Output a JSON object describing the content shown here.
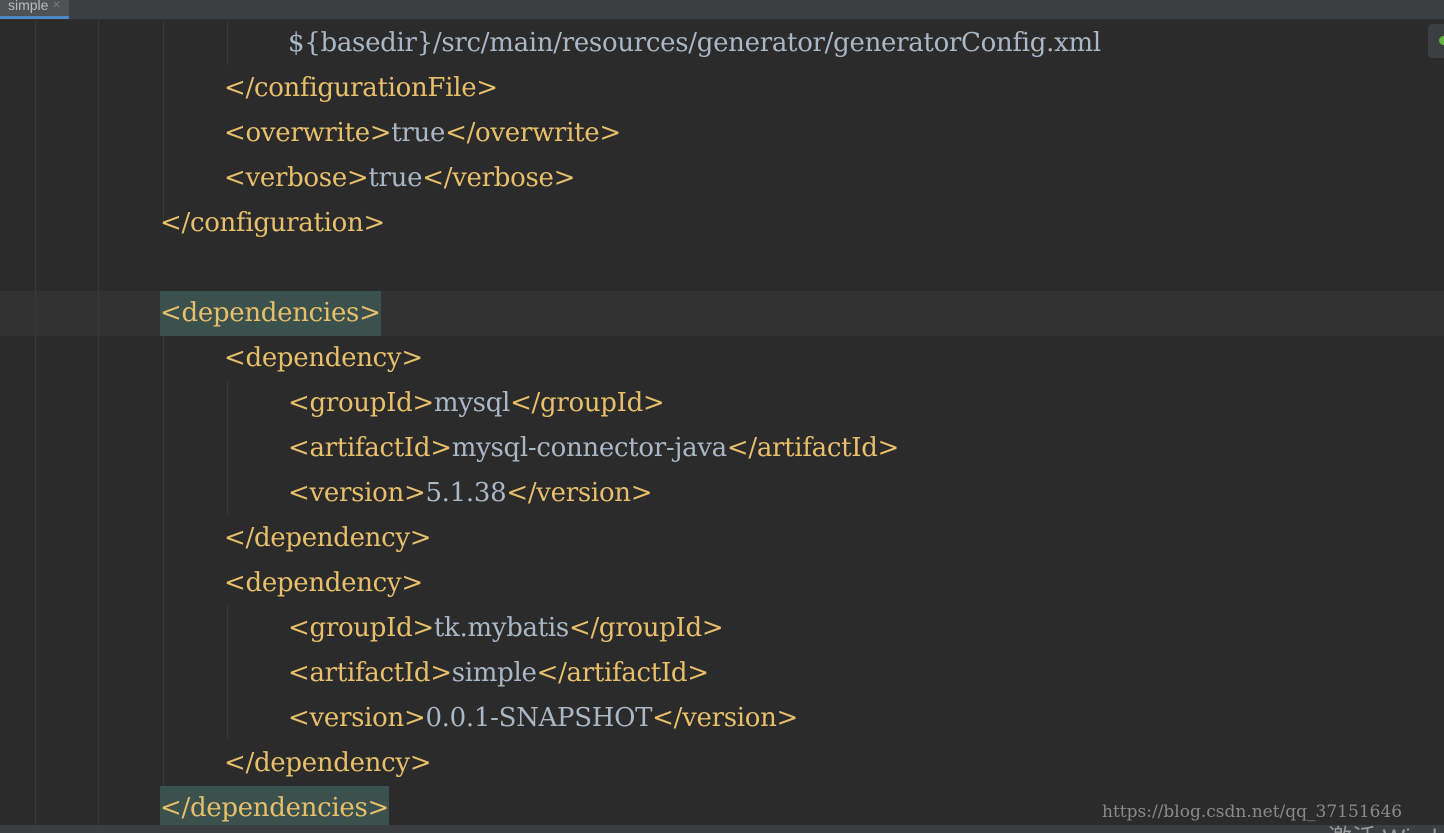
{
  "tab": {
    "label": "simple",
    "close_glyph": "×"
  },
  "code": [
    {
      "segments": [
        {
          "t": "${basedir}/src/main/resources/generator/generatorConfig.xml",
          "k": "txt"
        }
      ]
    },
    {
      "segments": [
        {
          "t": "</configurationFile>",
          "k": "tag"
        }
      ]
    },
    {
      "segments": [
        {
          "t": "<overwrite>",
          "k": "tag"
        },
        {
          "t": "true",
          "k": "txt"
        },
        {
          "t": "</overwrite>",
          "k": "tag"
        }
      ]
    },
    {
      "segments": [
        {
          "t": "<verbose>",
          "k": "tag"
        },
        {
          "t": "true",
          "k": "txt"
        },
        {
          "t": "</verbose>",
          "k": "tag"
        }
      ]
    },
    {
      "segments": [
        {
          "t": "</configuration>",
          "k": "tag"
        }
      ]
    },
    {
      "segments": []
    },
    {
      "segments": [
        {
          "t": "<dependencies>",
          "k": "tag",
          "hl": true
        }
      ]
    },
    {
      "segments": [
        {
          "t": "<dependency>",
          "k": "tag"
        }
      ]
    },
    {
      "segments": [
        {
          "t": "<groupId>",
          "k": "tag"
        },
        {
          "t": "mysql",
          "k": "txt"
        },
        {
          "t": "</groupId>",
          "k": "tag"
        }
      ]
    },
    {
      "segments": [
        {
          "t": "<artifactId>",
          "k": "tag"
        },
        {
          "t": "mysql-connector-java",
          "k": "txt"
        },
        {
          "t": "</artifactId>",
          "k": "tag"
        }
      ]
    },
    {
      "segments": [
        {
          "t": "<version>",
          "k": "tag"
        },
        {
          "t": "5.1.38",
          "k": "txt"
        },
        {
          "t": "</version>",
          "k": "tag"
        }
      ]
    },
    {
      "segments": [
        {
          "t": "</dependency>",
          "k": "tag"
        }
      ]
    },
    {
      "segments": [
        {
          "t": "<dependency>",
          "k": "tag"
        }
      ]
    },
    {
      "segments": [
        {
          "t": "<groupId>",
          "k": "tag"
        },
        {
          "t": "tk.mybatis",
          "k": "txt"
        },
        {
          "t": "</groupId>",
          "k": "tag"
        }
      ]
    },
    {
      "segments": [
        {
          "t": "<artifactId>",
          "k": "tag"
        },
        {
          "t": "simple",
          "k": "txt"
        },
        {
          "t": "</artifactId>",
          "k": "tag"
        }
      ]
    },
    {
      "segments": [
        {
          "t": "<version>",
          "k": "tag"
        },
        {
          "t": "0.0.1-SNAPSHOT",
          "k": "txt"
        },
        {
          "t": "</version>",
          "k": "tag"
        }
      ]
    },
    {
      "segments": [
        {
          "t": "</dependency>",
          "k": "tag"
        }
      ]
    },
    {
      "segments": [
        {
          "t": "</dependencies>",
          "k": "tag",
          "hl": true
        }
      ]
    }
  ],
  "watermark": "https://blog.csdn.net/qq_37151646",
  "os_overlay": "激活 Wind",
  "colors": {
    "background": "#2b2b2b",
    "tag": "#e8bf6a",
    "text": "#a9b7c6",
    "tag_match_highlight": "#3b514d",
    "status_ok": "#62b543"
  }
}
